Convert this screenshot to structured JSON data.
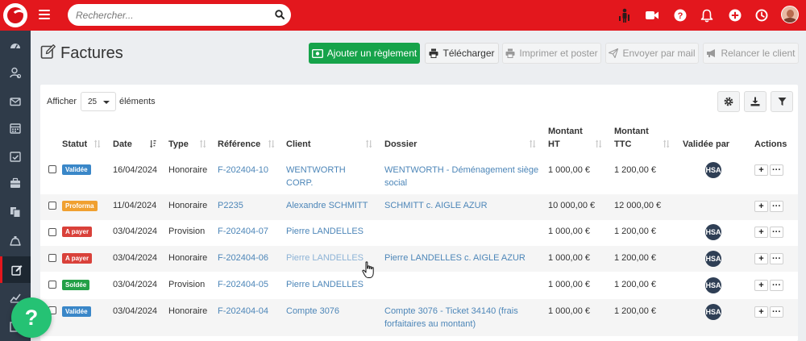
{
  "topbar": {
    "search_placeholder": "Rechercher...",
    "icons": [
      "hamburger-icon",
      "search-icon",
      "stats-person-icon",
      "video-icon",
      "help-icon",
      "bell-icon",
      "plus-icon",
      "clock-icon",
      "avatar"
    ]
  },
  "sidebar": {
    "items": [
      "dashboard-icon",
      "contacts-icon",
      "mail-icon",
      "calendar-icon",
      "tasks-icon",
      "briefcase-icon",
      "documents-icon",
      "timer-icon",
      "invoices-icon",
      "chart-icon",
      "export-icon"
    ],
    "active_index": 8
  },
  "page": {
    "title": "Factures",
    "buttons": {
      "add_payment": "Ajouter un règlement",
      "download": "Télécharger",
      "print_post": "Imprimer et poster",
      "send_mail": "Envoyer par mail",
      "remind": "Relancer le client"
    }
  },
  "table_controls": {
    "show_label": "Afficher",
    "page_size": "25",
    "elements_label": "éléments"
  },
  "table": {
    "headers": {
      "statut": "Statut",
      "date": "Date",
      "type": "Type",
      "reference": "Référence",
      "client": "Client",
      "dossier": "Dossier",
      "montant_ht_1": "Montant",
      "montant_ht_2": "HT",
      "montant_ttc_1": "Montant",
      "montant_ttc_2": "TTC",
      "validee_par": "Validée par",
      "actions": "Actions"
    },
    "rows": [
      {
        "status": "Validée",
        "status_color": "#3a87c8",
        "date": "16/04/2024",
        "type": "Honoraire",
        "reference": "F-202404-10",
        "client_1": "WENTWORTH",
        "client_2": "CORP.",
        "dossier_1": "WENTWORTH - Déménagement siège",
        "dossier_2": "social",
        "ht": "1 000,00 €",
        "ttc": "1 200,00 €",
        "validated_by": "HSA"
      },
      {
        "status": "Proforma",
        "status_color": "#f0a030",
        "date": "11/04/2024",
        "type": "Honoraire",
        "reference": "P2235",
        "client_1": "Alexandre SCHMITT",
        "client_2": "",
        "dossier_1": "SCHMITT c. AIGLE AZUR",
        "dossier_2": "",
        "ht": "10 000,00 €",
        "ttc": "12 000,00 €",
        "validated_by": ""
      },
      {
        "status": "A payer",
        "status_color": "#d9413a",
        "date": "03/04/2024",
        "type": "Provision",
        "reference": "F-202404-07",
        "client_1": "Pierre LANDELLES",
        "client_2": "",
        "dossier_1": "",
        "dossier_2": "",
        "ht": "1 000,00 €",
        "ttc": "1 200,00 €",
        "validated_by": "HSA"
      },
      {
        "status": "A payer",
        "status_color": "#d9413a",
        "date": "03/04/2024",
        "type": "Honoraire",
        "reference": "F-202404-06",
        "client_1": "Pierre LANDELLES",
        "client_2": "",
        "dossier_1": "Pierre LANDELLES c. AIGLE AZUR",
        "dossier_2": "",
        "ht": "1 000,00 €",
        "ttc": "1 200,00 €",
        "validated_by": "HSA"
      },
      {
        "status": "Soldée",
        "status_color": "#23a047",
        "date": "03/04/2024",
        "type": "Provision",
        "reference": "F-202404-05",
        "client_1": "Pierre LANDELLES",
        "client_2": "",
        "dossier_1": "",
        "dossier_2": "",
        "ht": "1 000,00 €",
        "ttc": "1 200,00 €",
        "validated_by": "HSA"
      },
      {
        "status": "Validée",
        "status_color": "#3a87c8",
        "date": "03/04/2024",
        "type": "Honoraire",
        "reference": "F-202404-04",
        "client_1": "Compte 3076",
        "client_2": "",
        "dossier_1": "Compte 3076 - Ticket 34140 (frais",
        "dossier_2": "forfaitaires au montant)",
        "ht": "1 000,00 €",
        "ttc": "1 200,00 €",
        "validated_by": "HSA"
      }
    ],
    "action_add": "+",
    "action_more": "···"
  },
  "help_button": "?"
}
